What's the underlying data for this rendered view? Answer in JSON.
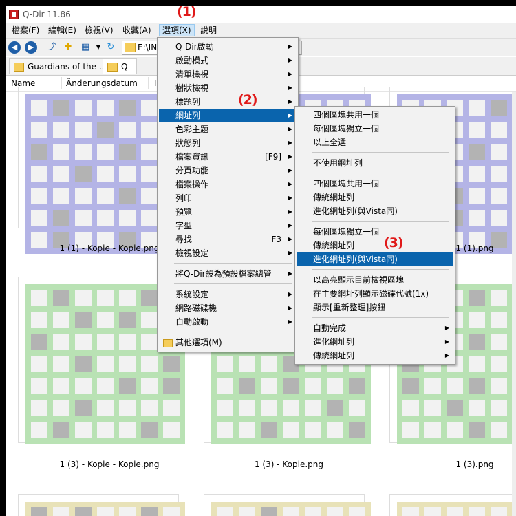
{
  "window": {
    "title": "Q-Dir 11.86"
  },
  "menubar": [
    "檔案(F)",
    "編輯(E)",
    "檢視(V)",
    "收藏(A)",
    "選項(X)",
    "說明"
  ],
  "toolbar": {
    "back_icon": "back-arrow-icon",
    "forward_icon": "forward-arrow-icon",
    "address": "E:\\INI"
  },
  "tabs": [
    "Guardians of the ...",
    "Q"
  ],
  "columns": [
    "Name",
    "Änderungsdatum",
    "T"
  ],
  "files": [
    "1 (1) - Kopie - Kopie.png",
    "1 (1).png",
    "1 (3) - Kopie - Kopie.png",
    "1 (3) - Kopie.png",
    "1 (3).png"
  ],
  "options_menu": {
    "items": [
      {
        "label": "Q-Dir啟動",
        "submenu": true
      },
      {
        "label": "啟動模式",
        "submenu": true
      },
      {
        "label": "清單檢視",
        "submenu": true
      },
      {
        "label": "樹狀檢視",
        "submenu": true
      },
      {
        "label": "標題列",
        "submenu": true
      },
      {
        "label": "網址列",
        "submenu": true,
        "highlighted": true
      },
      {
        "label": "色彩主題",
        "submenu": true
      },
      {
        "label": "狀態列",
        "submenu": true
      },
      {
        "label": "檔案資訊",
        "shortcut": "[F9]",
        "submenu": true
      },
      {
        "label": "分頁功能",
        "submenu": true
      },
      {
        "label": "檔案操作",
        "submenu": true
      },
      {
        "label": "列印",
        "submenu": true
      },
      {
        "label": "預覽",
        "submenu": true
      },
      {
        "label": "字型",
        "submenu": true
      },
      {
        "label": "尋找",
        "shortcut": "F3",
        "submenu": true
      },
      {
        "label": "檢視設定",
        "submenu": true
      },
      {
        "label": "將Q-Dir設為預設檔案總管",
        "submenu": true
      },
      {
        "label": "系統設定",
        "submenu": true
      },
      {
        "label": "網路磁碟機",
        "submenu": true
      },
      {
        "label": "自動啟動",
        "submenu": true
      },
      {
        "label": "其他選項(M)",
        "submenu": false
      }
    ]
  },
  "address_submenu": {
    "items": [
      {
        "label": "四個區塊共用一個"
      },
      {
        "label": "每個區塊獨立一個"
      },
      {
        "label": "以上全選"
      },
      {
        "label": "不使用網址列"
      },
      {
        "label": "四個區塊共用一個"
      },
      {
        "label": "傳統網址列"
      },
      {
        "label": "進化網址列(與Vista同)"
      },
      {
        "label": "每個區塊獨立一個"
      },
      {
        "label": "傳統網址列"
      },
      {
        "label": "進化網址列(與Vista同)",
        "highlighted": true
      },
      {
        "label": "以高亮顯示目前檢視區塊"
      },
      {
        "label": "在主要網址列顯示磁碟代號(1x)"
      },
      {
        "label": "顯示[重新整理]按鈕"
      },
      {
        "label": "自動完成",
        "submenu": true
      },
      {
        "label": "進化網址列",
        "submenu": true
      },
      {
        "label": "傳統網址列",
        "submenu": true
      }
    ]
  },
  "annotations": [
    "(1)",
    "(2)",
    "(3)"
  ],
  "colors": {
    "highlight": "#0a64ad",
    "annotation": "#e01a1a",
    "thumb_blue": "#b4b4e6",
    "thumb_green": "#b9e2b4",
    "thumb_yellow": "#e8e2b8"
  }
}
